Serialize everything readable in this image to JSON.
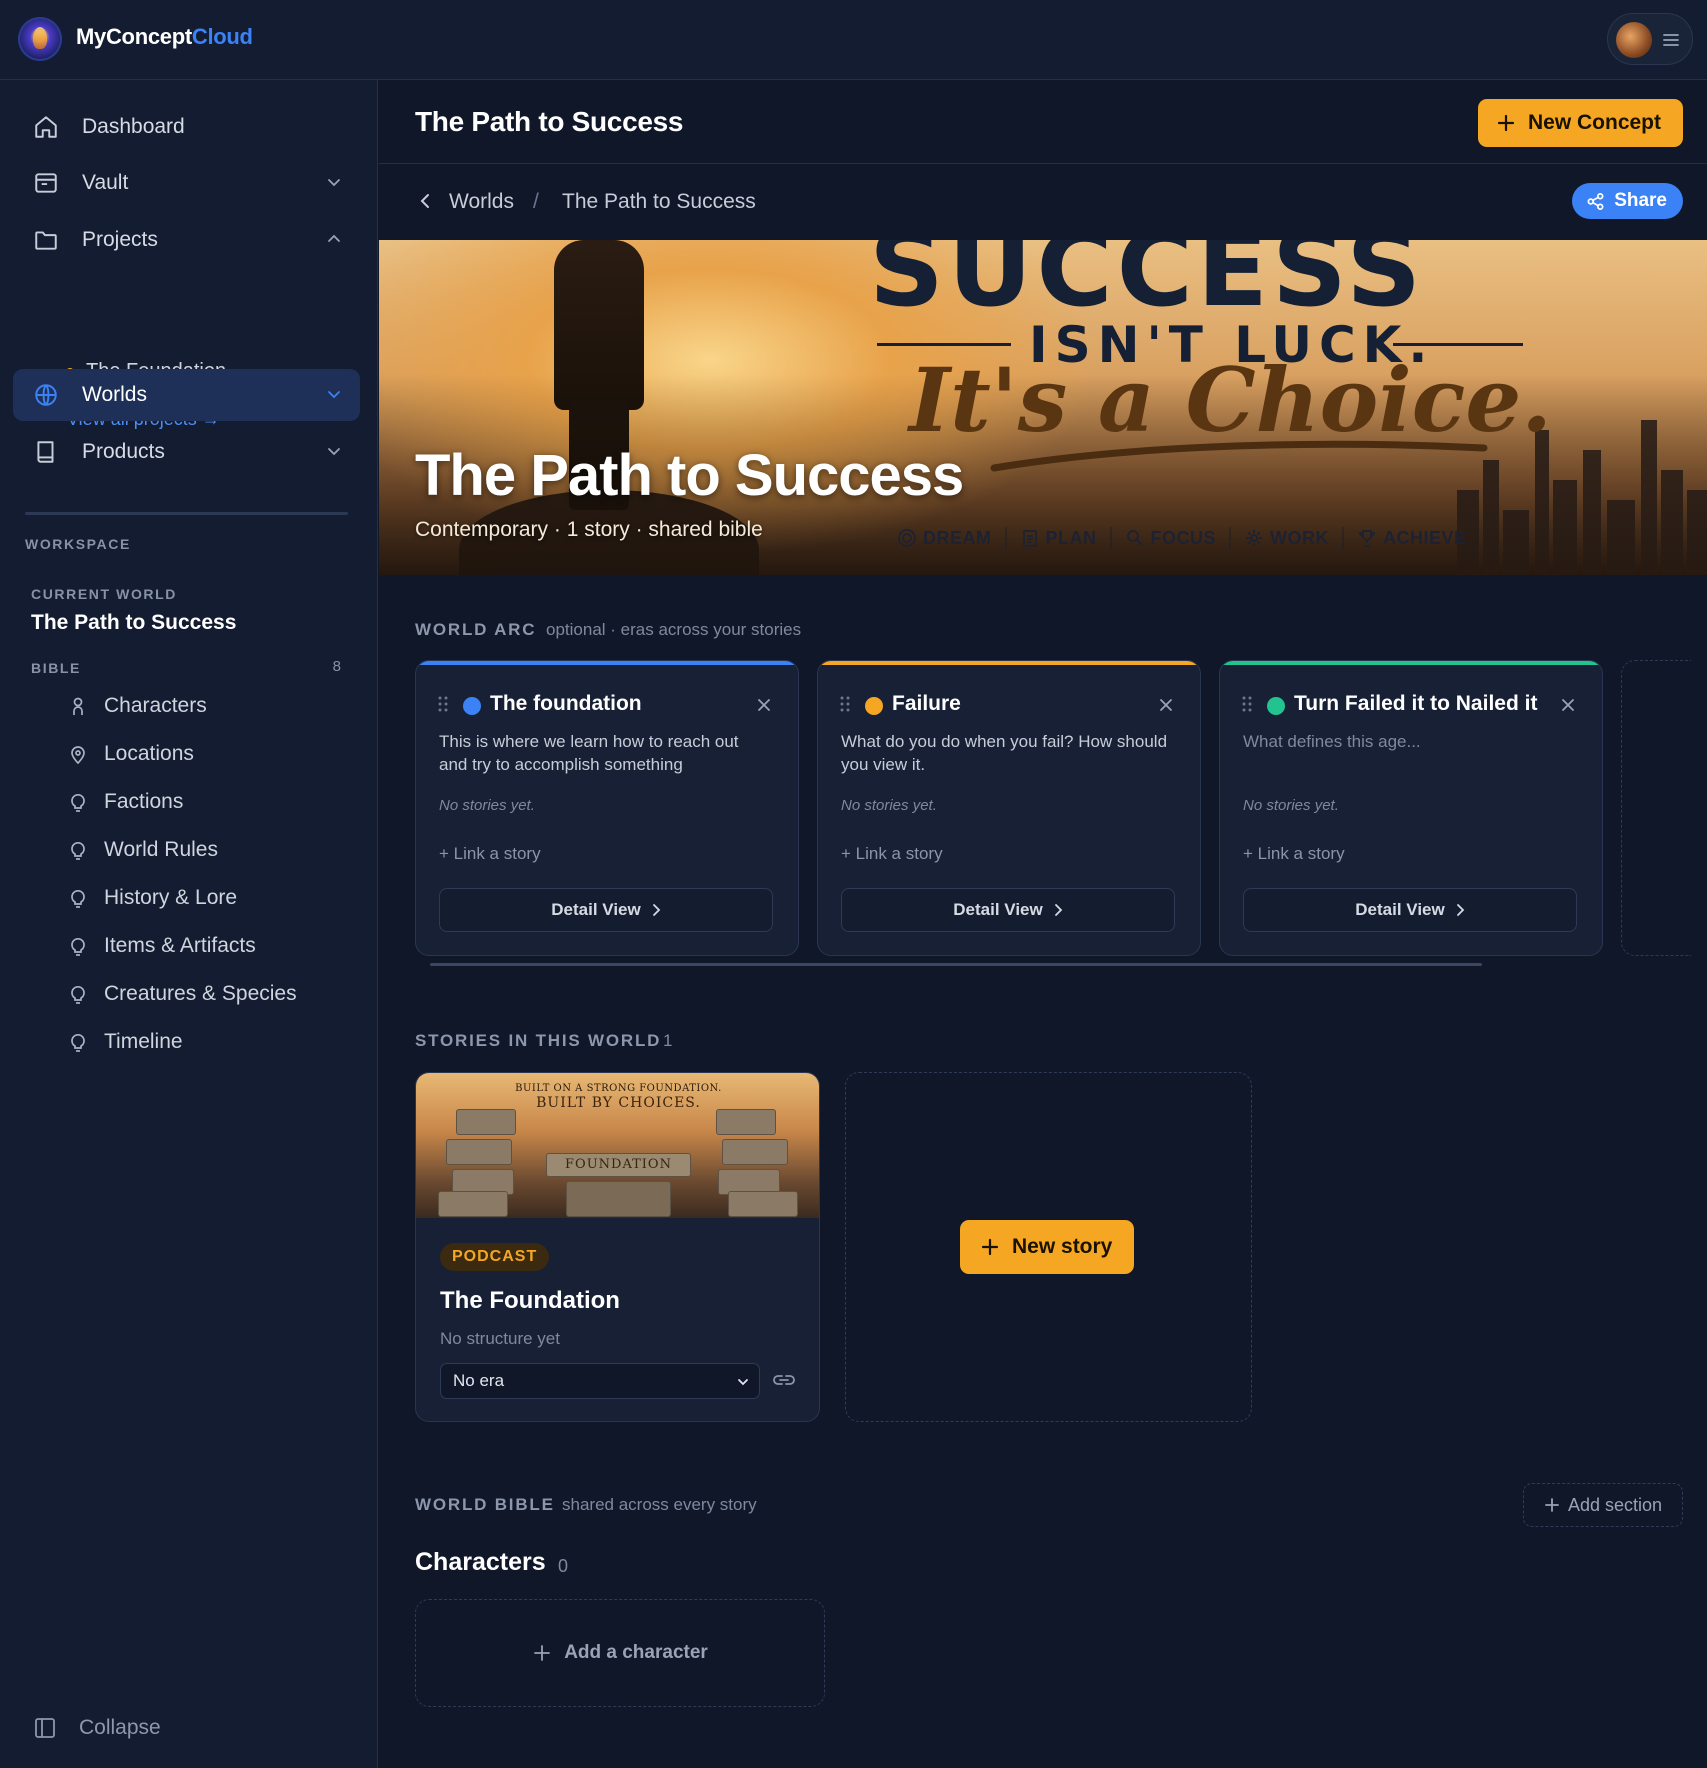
{
  "brand": {
    "name_a": "MyConcept",
    "name_b": "Cloud"
  },
  "sidebar": {
    "nav": [
      {
        "label": "Dashboard",
        "icon": "home-icon"
      },
      {
        "label": "Vault",
        "icon": "vault-icon"
      },
      {
        "label": "Projects",
        "icon": "folder-icon"
      },
      {
        "label": "Worlds",
        "icon": "globe-icon",
        "active": true
      },
      {
        "label": "Products",
        "icon": "book-icon"
      }
    ],
    "project_item": "The Foundation",
    "view_all": "View all projects →",
    "workspace_label": "WORKSPACE",
    "current_world_label": "CURRENT WORLD",
    "current_world": "The Path to Success",
    "bible_label": "BIBLE",
    "bible_count": "8",
    "bible_items": [
      "Characters",
      "Locations",
      "Factions",
      "World Rules",
      "History & Lore",
      "Items & Artifacts",
      "Creatures & Species",
      "Timeline"
    ],
    "collapse": "Collapse"
  },
  "header": {
    "title": "The Path to Success",
    "new_concept": "New Concept"
  },
  "breadcrumb": {
    "parent": "Worlds",
    "separator": "/",
    "current": "The Path to Success",
    "share": "Share"
  },
  "hero": {
    "big_word": "SUCCESS",
    "tagline": "ISN'T LUCK.",
    "script": "It's a Choice.",
    "title": "The Path to Success",
    "subtitle": "Contemporary · 1 story · shared bible",
    "tags": [
      "DREAM",
      "PLAN",
      "FOCUS",
      "WORK",
      "ACHIEVE"
    ]
  },
  "world_arc": {
    "label": "WORLD ARC",
    "note": "optional · eras across your stories",
    "eras": [
      {
        "name": "The foundation",
        "color": "#3b82f6",
        "description": "This is where we learn how to reach out and try to accomplish something",
        "placeholder": false,
        "no_stories": "No stories yet.",
        "link": "+ Link a story",
        "detail": "Detail View"
      },
      {
        "name": "Failure",
        "color": "#f5a623",
        "description": "What do you do when you fail?  How should you view it.",
        "placeholder": false,
        "no_stories": "No stories yet.",
        "link": "+ Link a story",
        "detail": "Detail View"
      },
      {
        "name": "Turn Failed it to Nailed it",
        "color": "#22c38e",
        "description": "What defines this age...",
        "placeholder": true,
        "no_stories": "No stories yet.",
        "link": "+ Link a story",
        "detail": "Detail View"
      }
    ]
  },
  "stories": {
    "label": "STORIES IN THIS WORLD",
    "count": "1",
    "items": [
      {
        "badge": "PODCAST",
        "title": "The Foundation",
        "subtitle": "No structure yet",
        "era": "No era",
        "thumb_line1": "BUILT ON A STRONG FOUNDATION.",
        "thumb_line2": "BUILT BY CHOICES.",
        "thumb_center": "FOUNDATION"
      }
    ],
    "new_story": "New story"
  },
  "world_bible": {
    "label": "WORLD BIBLE",
    "note": "shared across every story",
    "add_section": "Add section",
    "section_title": "Characters",
    "section_count": "0",
    "add_character": "Add a character"
  }
}
